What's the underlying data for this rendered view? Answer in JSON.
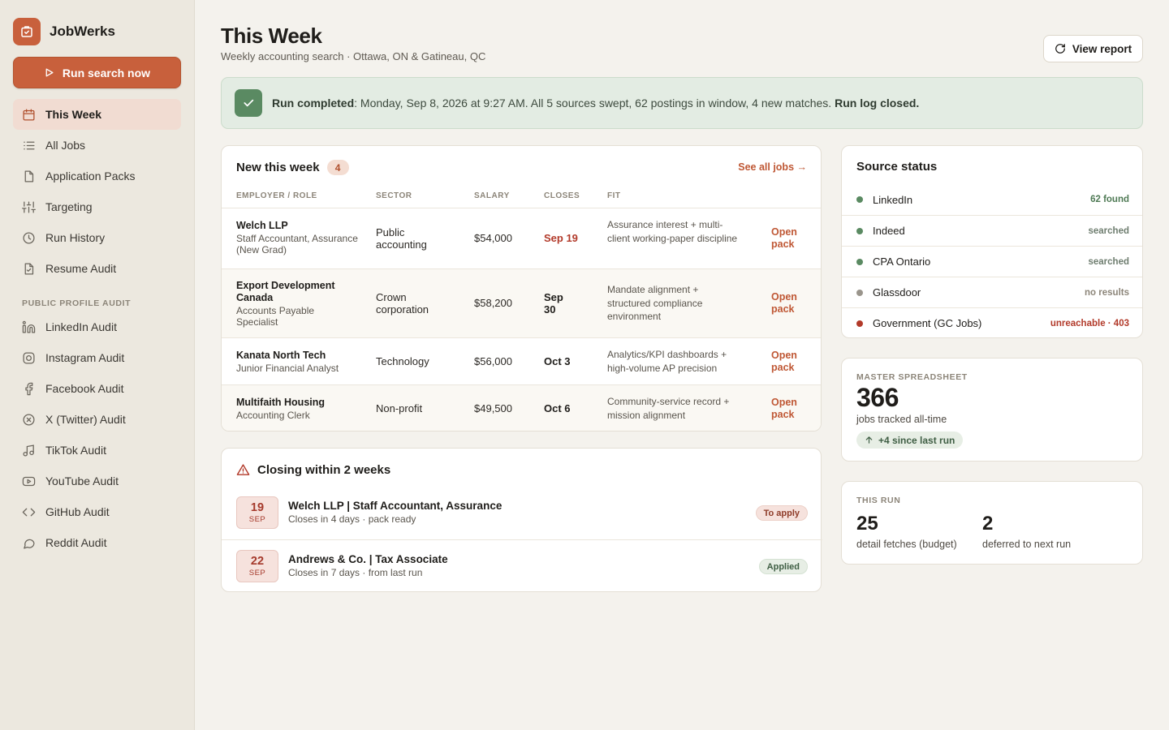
{
  "app": {
    "name": "JobWerks",
    "run_button": "Run search now"
  },
  "nav": {
    "items": [
      {
        "label": "This Week",
        "icon": "calendar-icon",
        "active": true
      },
      {
        "label": "All Jobs",
        "icon": "list-icon"
      },
      {
        "label": "Application Packs",
        "icon": "file-icon"
      },
      {
        "label": "Targeting",
        "icon": "sliders-icon"
      },
      {
        "label": "Run History",
        "icon": "clock-icon"
      },
      {
        "label": "Resume Audit",
        "icon": "file-check-icon"
      }
    ],
    "section_label": "PUBLIC PROFILE AUDIT",
    "audit_items": [
      {
        "label": "LinkedIn Audit",
        "icon": "linkedin-icon"
      },
      {
        "label": "Instagram Audit",
        "icon": "instagram-icon"
      },
      {
        "label": "Facebook Audit",
        "icon": "facebook-icon"
      },
      {
        "label": "X (Twitter) Audit",
        "icon": "x-icon"
      },
      {
        "label": "TikTok Audit",
        "icon": "music-note-icon"
      },
      {
        "label": "YouTube Audit",
        "icon": "youtube-icon"
      },
      {
        "label": "GitHub Audit",
        "icon": "code-icon"
      },
      {
        "label": "Reddit Audit",
        "icon": "chat-bubble-icon"
      }
    ]
  },
  "header": {
    "title": "This Week",
    "subtitle": "Weekly accounting search · Ottawa, ON & Gatineau, QC",
    "view_report": "View report"
  },
  "banner": {
    "lead": "Run completed",
    "text": ": Monday, Sep 8, 2026 at 9:27 AM. All 5 sources swept, 62 postings in window, 4 new matches. ",
    "tail": "Run log closed."
  },
  "new_jobs": {
    "title": "New this week",
    "count": "4",
    "see_all": "See all jobs →",
    "columns": [
      "EMPLOYER / ROLE",
      "SECTOR",
      "SALARY",
      "CLOSES",
      "FIT"
    ],
    "action_label": "Open pack",
    "rows": [
      {
        "employer": "Welch LLP",
        "role": "Staff Accountant, Assurance (New Grad)",
        "sector": "Public accounting",
        "salary": "$54,000",
        "closes": "Sep 19",
        "urgent": true,
        "fit": "Assurance interest + multi-client working-paper discipline"
      },
      {
        "employer": "Export Development Canada",
        "role": "Accounts Payable Specialist",
        "sector": "Crown corporation",
        "salary": "$58,200",
        "closes": "Sep 30",
        "urgent": false,
        "fit": "Mandate alignment + structured compliance environment"
      },
      {
        "employer": "Kanata North Tech",
        "role": "Junior Financial Analyst",
        "sector": "Technology",
        "salary": "$56,000",
        "closes": "Oct 3",
        "urgent": false,
        "fit": "Analytics/KPI dashboards + high-volume AP precision"
      },
      {
        "employer": "Multifaith Housing",
        "role": "Accounting Clerk",
        "sector": "Non-profit",
        "salary": "$49,500",
        "closes": "Oct 6",
        "urgent": false,
        "fit": "Community-service record + mission alignment"
      }
    ]
  },
  "closing": {
    "title": "Closing within 2 weeks",
    "items": [
      {
        "day": "19",
        "month": "SEP",
        "title": "Welch LLP | Staff Accountant, Assurance",
        "sub": "Closes in 4 days · pack ready",
        "tag": "To apply"
      },
      {
        "day": "22",
        "month": "SEP",
        "title": "Andrews & Co. | Tax Associate",
        "sub": "Closes in 7 days · from last run",
        "tag": "Applied"
      }
    ]
  },
  "sources": {
    "title": "Source status",
    "items": [
      {
        "name": "LinkedIn",
        "status": "62 found",
        "color": "#5a8a62"
      },
      {
        "name": "Indeed",
        "status": "searched",
        "color": "#5a8a62"
      },
      {
        "name": "CPA Ontario",
        "status": "searched",
        "color": "#5a8a62"
      },
      {
        "name": "Glassdoor",
        "status": "no results",
        "color": "#9a958c"
      },
      {
        "name": "Government (GC Jobs)",
        "status": "unreachable · 403",
        "color": "#b23a2a"
      }
    ]
  },
  "master": {
    "label": "MASTER SPREADSHEET",
    "value": "366",
    "caption": "jobs tracked all-time",
    "delta": "+4 since last run"
  },
  "this_run": {
    "label": "THIS RUN",
    "stats": [
      {
        "value": "25",
        "caption": "detail fetches (budget)"
      },
      {
        "value": "2",
        "caption": "deferred to next run"
      }
    ]
  },
  "colors": {
    "accent": "#c8603c",
    "success": "#5a8a62",
    "danger": "#b23a2a"
  }
}
